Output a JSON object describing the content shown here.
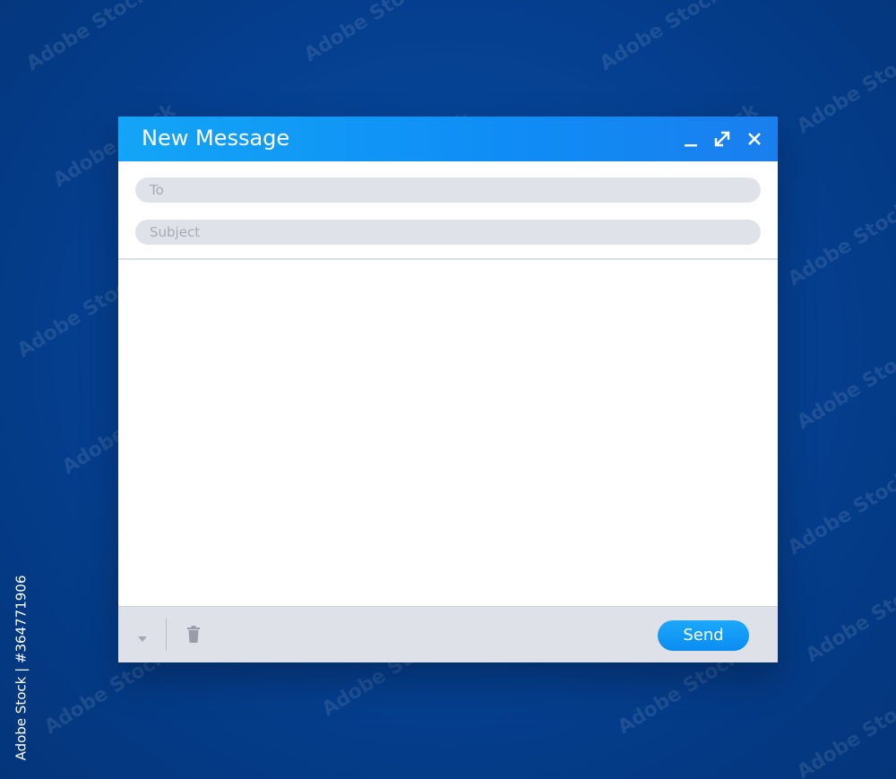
{
  "window": {
    "title": "New Message",
    "controls": [
      "minimize-icon",
      "expand-icon",
      "close-icon"
    ]
  },
  "compose": {
    "to_placeholder": "To",
    "to_value": "",
    "subject_placeholder": "Subject",
    "subject_value": "",
    "body_value": ""
  },
  "footer": {
    "send_label": "Send",
    "icons": [
      "dropdown-arrow-icon",
      "trash-icon"
    ]
  },
  "stock_id": "364771906",
  "watermark_text": "Adobe Stock",
  "colors": {
    "background": "#053f8f",
    "titlebar_start": "#13a5f7",
    "titlebar_end": "#1a7fee",
    "field": "#e0e2ea",
    "footer": "#dfe1e9",
    "send_button": "#0f98f5"
  }
}
